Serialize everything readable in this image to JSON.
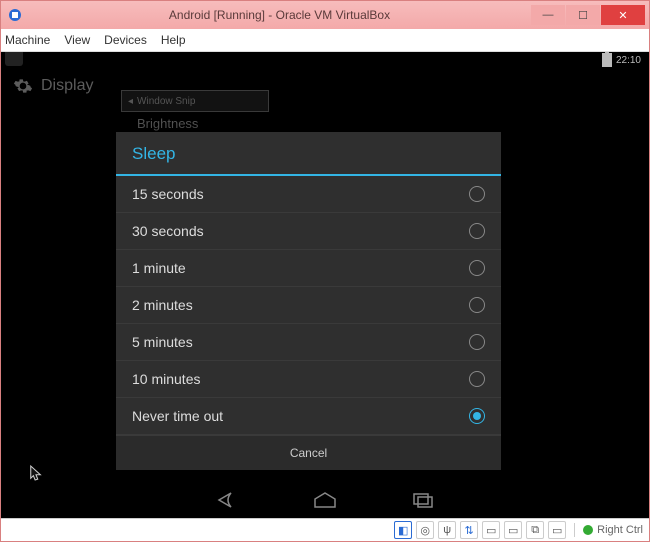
{
  "window": {
    "title": "Android [Running] - Oracle VM VirtualBox"
  },
  "menubar": {
    "items": [
      "Machine",
      "View",
      "Devices",
      "Help"
    ]
  },
  "android": {
    "status_time": "22:10",
    "settings_title": "Display",
    "snip_label": "Window Snip",
    "brightness_label": "Brightness"
  },
  "dialog": {
    "title": "Sleep",
    "options": [
      "15 seconds",
      "30 seconds",
      "1 minute",
      "2 minutes",
      "5 minutes",
      "10 minutes",
      "Never time out"
    ],
    "selected_index": 6,
    "cancel_label": "Cancel"
  },
  "vbox_status": {
    "hostkey_label": "Right Ctrl"
  }
}
